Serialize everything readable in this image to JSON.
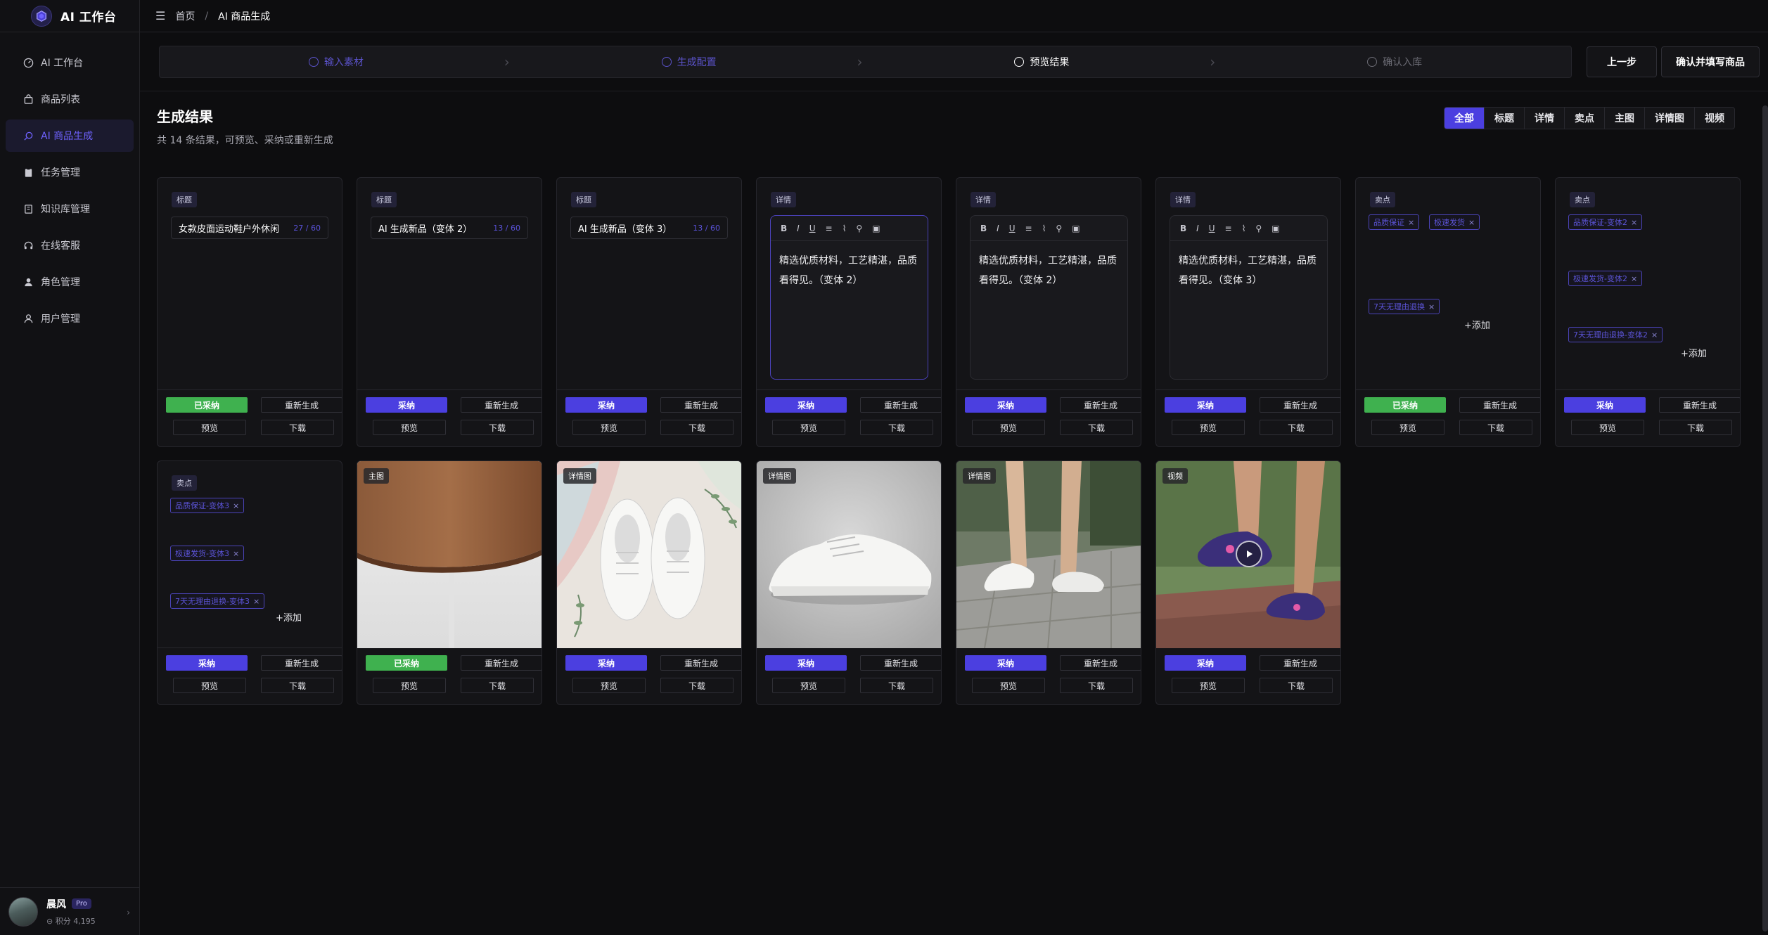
{
  "app": {
    "title": "AI 工作台"
  },
  "sidebar": {
    "items": [
      {
        "label": "AI 工作台",
        "icon": "dashboard-icon",
        "active": false
      },
      {
        "label": "商品列表",
        "icon": "bag-icon",
        "active": false
      },
      {
        "label": "AI 商品生成",
        "icon": "sparkle-icon",
        "active": true
      },
      {
        "label": "任务管理",
        "icon": "clipboard-icon",
        "active": false
      },
      {
        "label": "知识库管理",
        "icon": "book-icon",
        "active": false
      },
      {
        "label": "在线客服",
        "icon": "headset-icon",
        "active": false
      },
      {
        "label": "角色管理",
        "icon": "person-icon",
        "active": false
      },
      {
        "label": "用户管理",
        "icon": "user-icon",
        "active": false
      }
    ],
    "user": {
      "name": "晨风",
      "badge": "Pro",
      "points": "⊝ 积分 4,195"
    }
  },
  "breadcrumb": {
    "home": "首页",
    "sep": "/",
    "current": "AI 商品生成"
  },
  "steps": [
    {
      "label": "输入素材",
      "state": "done"
    },
    {
      "label": "生成配置",
      "state": "done"
    },
    {
      "label": "预览结果",
      "state": "current"
    },
    {
      "label": "确认入库",
      "state": "todo"
    }
  ],
  "actions": {
    "prev": "上一步",
    "confirm": "确认并填写商品"
  },
  "section": {
    "title": "生成结果",
    "subtitle": "共 14 条结果，可预览、采纳或重新生成"
  },
  "filters": [
    "全部",
    "标题",
    "详情",
    "卖点",
    "主图",
    "详情图",
    "视频"
  ],
  "buttons": {
    "adopt": "采纳",
    "adopted": "已采纳",
    "regen": "重新生成",
    "preview": "预览",
    "download": "下载",
    "add": "+添加"
  },
  "toolbar": {
    "bold": "B",
    "italic": "I",
    "underline": "U",
    "list": "≡",
    "strike": "⌇",
    "link": "⚲",
    "image": "▣"
  },
  "cards": [
    {
      "type": "title",
      "tag": "标题",
      "value": "女款皮面运动鞋户外休闲",
      "count": "27 / 60",
      "adopted": true
    },
    {
      "type": "title",
      "tag": "标题",
      "value": "AI 生成新品（变体 2）",
      "count": "13 / 60",
      "adopted": false
    },
    {
      "type": "title",
      "tag": "标题",
      "value": "AI 生成新品（变体 3）",
      "count": "13 / 60",
      "adopted": false
    },
    {
      "type": "detail",
      "tag": "详情",
      "text": "精选优质材料，工艺精湛，品质看得见。（变体 2）",
      "adopted": false
    },
    {
      "type": "detail",
      "tag": "详情",
      "text": "精选优质材料，工艺精湛，品质看得见。（变体 2）",
      "adopted": false
    },
    {
      "type": "detail",
      "tag": "详情",
      "text": "精选优质材料，工艺精湛，品质看得见。（变体 3）",
      "adopted": false
    },
    {
      "type": "selling",
      "tag": "卖点",
      "chips": [
        "品质保证",
        "极速发货",
        "7天无理由退换"
      ],
      "adopted": true
    },
    {
      "type": "selling",
      "tag": "卖点",
      "chips": [
        "品质保证-变体2",
        "极速发货-变体2",
        "7天无理由退换-变体2"
      ],
      "adopted": false
    },
    {
      "type": "selling",
      "tag": "卖点",
      "chips": [
        "品质保证-变体3",
        "极速发货-变体3",
        "7天无理由退换-变体3"
      ],
      "adopted": false
    },
    {
      "type": "image",
      "tag": "主图",
      "adopted": true
    },
    {
      "type": "image",
      "tag": "详情图",
      "adopted": false
    },
    {
      "type": "image",
      "tag": "详情图",
      "adopted": false
    },
    {
      "type": "image",
      "tag": "详情图",
      "adopted": false
    },
    {
      "type": "video",
      "tag": "视频",
      "adopted": false
    }
  ],
  "colors": {
    "accent": "#4b3fe0",
    "adopted": "#3fb14f",
    "background": "#0d0d0f"
  }
}
